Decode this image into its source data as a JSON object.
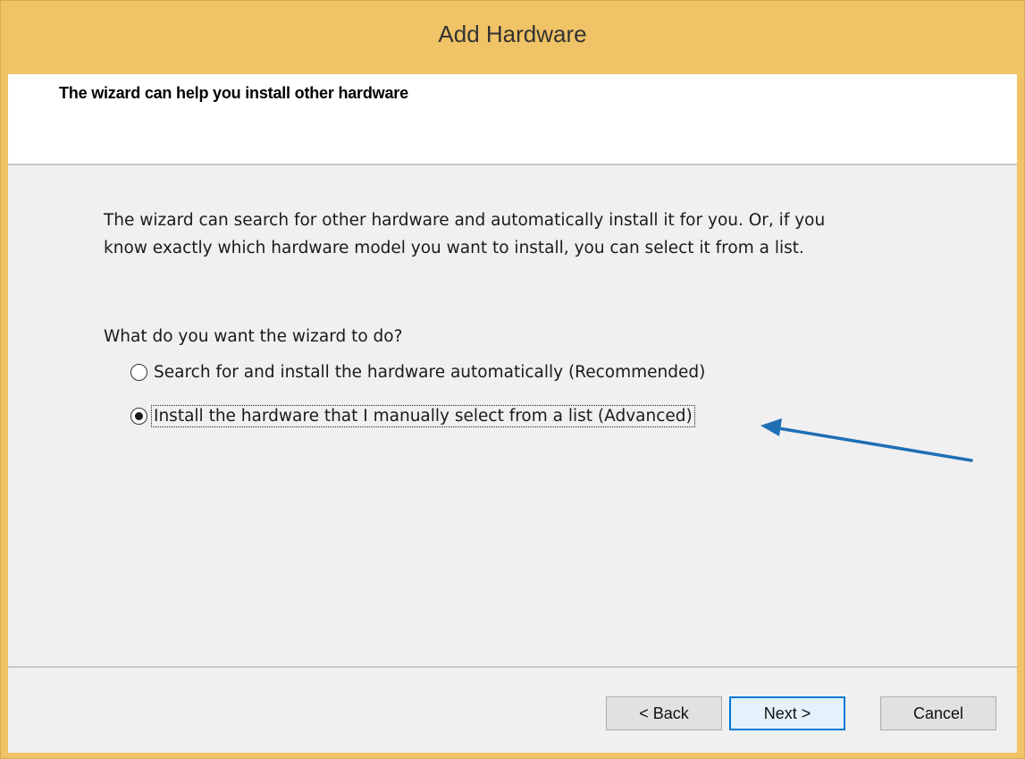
{
  "window": {
    "title": "Add Hardware"
  },
  "header": {
    "title": "The wizard can help you install other hardware"
  },
  "body": {
    "intro_line1": "The wizard can search for other hardware and automatically install it for you. Or, if you",
    "intro_line2": "know exactly which hardware model you want to install, you can select it from a list.",
    "question": "What do you want the wizard to do?",
    "options": [
      {
        "label": "Search for and install the hardware automatically (Recommended)",
        "selected": false
      },
      {
        "label": "Install the hardware that I manually select from a list (Advanced)",
        "selected": true
      }
    ]
  },
  "buttons": {
    "back": "< Back",
    "next": "Next >",
    "cancel": "Cancel"
  },
  "colors": {
    "titlebar": "#f0c366",
    "annotation_arrow": "#1f6fb5",
    "default_button_border": "#0078d7"
  }
}
